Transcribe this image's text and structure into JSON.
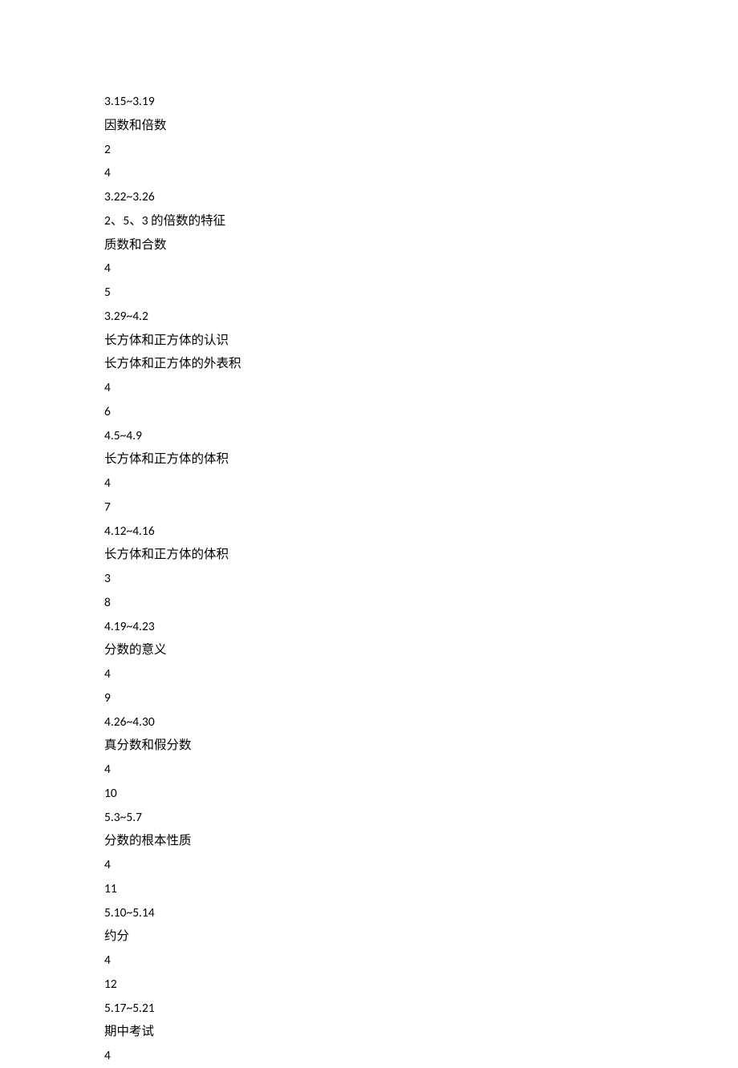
{
  "lines": [
    "3.15~3.19",
    "因数和倍数",
    "2",
    "4",
    "3.22~3.26",
    "2、5、3 的倍数的特征",
    "质数和合数",
    "4",
    "5",
    "3.29~4.2",
    "长方体和正方体的认识",
    "长方体和正方体的外表积",
    "4",
    "6",
    "4.5~4.9",
    "长方体和正方体的体积",
    "4",
    "7",
    "4.12~4.16",
    "长方体和正方体的体积",
    "3",
    "8",
    "4.19~4.23",
    "分数的意义",
    "4",
    "9",
    "4.26~4.30",
    "真分数和假分数",
    "4",
    "10",
    "5.3~5.7",
    "分数的根本性质",
    "4",
    "11",
    "5.10~5.14",
    "约分",
    "4",
    "12",
    "5.17~5.21",
    "期中考试",
    "4"
  ]
}
